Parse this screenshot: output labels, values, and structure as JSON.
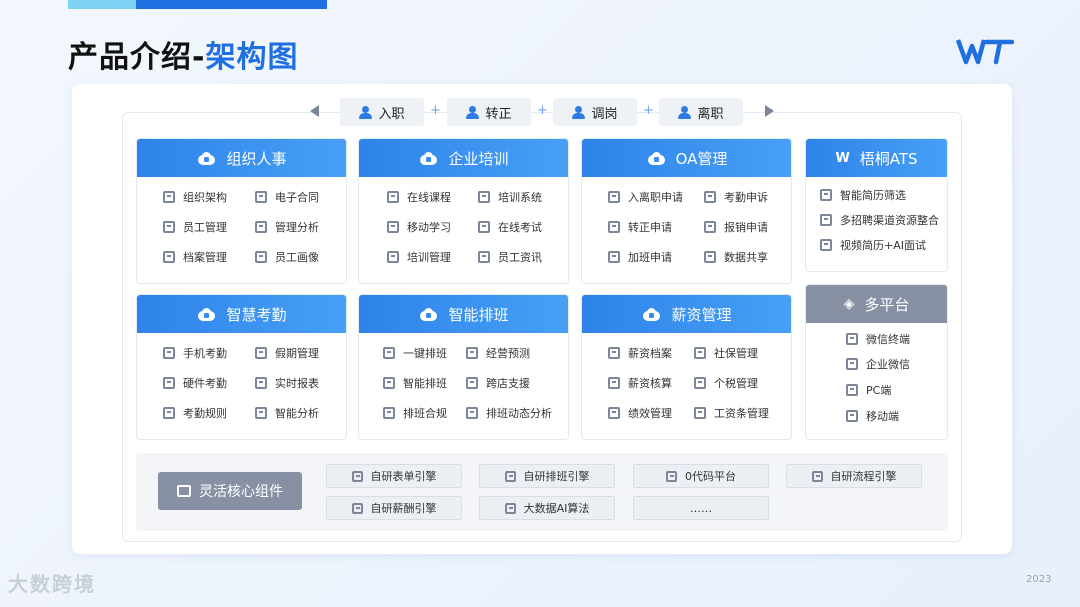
{
  "title": {
    "part1": "产品介绍-",
    "part2": "架构图"
  },
  "logo": {
    "text": "WT"
  },
  "flow": {
    "steps": [
      "入职",
      "转正",
      "调岗",
      "离职"
    ],
    "separator": "+"
  },
  "modules": [
    {
      "title": "组织人事",
      "icon": "cloud-icon",
      "items": [
        "组织架构",
        "电子合同",
        "员工管理",
        "管理分析",
        "档案管理",
        "员工画像"
      ]
    },
    {
      "title": "企业培训",
      "icon": "cloud-icon",
      "items": [
        "在线课程",
        "培训系统",
        "移动学习",
        "在线考试",
        "培训管理",
        "员工资讯"
      ]
    },
    {
      "title": "OA管理",
      "icon": "cloud-icon",
      "items": [
        "入离职申请",
        "考勤申诉",
        "转正申请",
        "报销申请",
        "加班申请",
        "数据共享"
      ]
    },
    {
      "title": "梧桐ATS",
      "icon": "wt-icon",
      "items": [
        "智能简历筛选",
        "多招聘渠道资源整合",
        "视频简历+AI面试"
      ]
    },
    {
      "title": "智慧考勤",
      "icon": "cloud-icon",
      "items": [
        "手机考勤",
        "假期管理",
        "硬件考勤",
        "实时报表",
        "考勤规则",
        "智能分析"
      ]
    },
    {
      "title": "智能排班",
      "icon": "cloud-icon",
      "items": [
        "一键排班",
        "经营预测",
        "智能排班",
        "跨店支援",
        "排班合规",
        "排班动态分析"
      ]
    },
    {
      "title": "薪资管理",
      "icon": "cloud-icon",
      "items": [
        "薪资档案",
        "社保管理",
        "薪资核算",
        "个税管理",
        "绩效管理",
        "工资条管理"
      ]
    },
    {
      "title": "多平台",
      "icon": "layers-icon",
      "items": [
        "微信终端",
        "企业微信",
        "PC端",
        "移动端"
      ]
    }
  ],
  "core": {
    "label": "灵活核心组件",
    "chips": [
      "自研表单引擎",
      "自研排班引擎",
      "0代码平台",
      "自研流程引擎",
      "自研薪酬引擎",
      "大数据AI算法",
      "……"
    ]
  },
  "footer": {
    "watermark": "大数跨境",
    "year": "2023"
  },
  "colors": {
    "accent": "#1f6fe0",
    "header_blue": "#2e83ea",
    "header_gray": "#8791a3"
  }
}
